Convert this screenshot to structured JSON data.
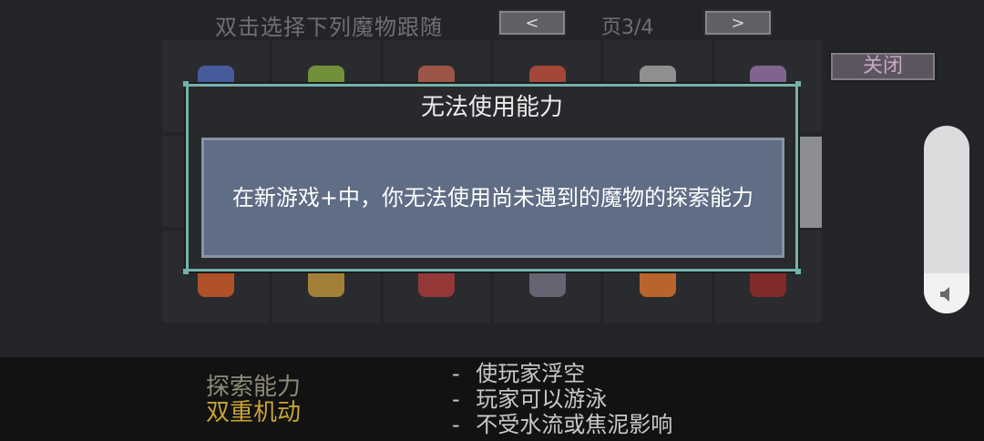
{
  "header": {
    "instruction": "双击选择下列魔物跟随",
    "prev_label": "<",
    "page": "页3/4",
    "next_label": ">"
  },
  "close_label": "关闭",
  "dialog": {
    "title": "无法使用能力",
    "message": "在新游戏+中，你无法使用尚未遇到的魔物的探索能力"
  },
  "bottom": {
    "label": "探索能力",
    "ability": "双重机动",
    "effects": [
      "使玩家浮空",
      "玩家可以游泳",
      "不受水流或焦泥影响"
    ]
  },
  "colors": {
    "dialog_border": "#74b2ac",
    "dialog_body": "#5f6d85",
    "ability_text": "#c8a434"
  },
  "monster_sprites": [
    "wizard",
    "plant",
    "fox",
    "lizard",
    "bird",
    "hooded",
    "blank",
    "blank",
    "blank",
    "blank",
    "blank",
    "blank",
    "crab",
    "goblin",
    "knight",
    "golem",
    "beast",
    "dragon"
  ]
}
